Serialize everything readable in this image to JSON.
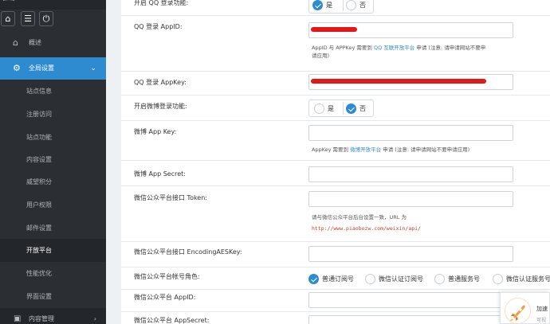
{
  "sidebar": {
    "overview": "概述",
    "global_settings": "全局设置",
    "sub_items": [
      "站点信息",
      "注册访问",
      "站点功能",
      "内容设置",
      "威望积分",
      "用户权限",
      "邮件设置",
      "开放平台",
      "性能优化",
      "界面设置"
    ],
    "active_sub": "开放平台",
    "content_management": "内容管理"
  },
  "form": {
    "qq_login_enable": {
      "label": "开启 QQ 登录功能:",
      "options": [
        "是",
        "否"
      ],
      "selected": "是"
    },
    "qq_appid": {
      "label": "QQ 登录 AppID:",
      "help_pre": "AppID 与 APPKey 需要到",
      "help_link": "QQ 互联开放平台",
      "help_post": "申请 (注意: 请申请网站不要申",
      "help_line2": "请应用)"
    },
    "qq_appkey": {
      "label": "QQ 登录 AppKey:"
    },
    "weibo_enable": {
      "label": "开启微博登录功能:",
      "options": [
        "是",
        "否"
      ],
      "selected": "否"
    },
    "weibo_appkey": {
      "label": "微博 App Key:",
      "help_pre": "AppKey 需要到",
      "help_link": "微博开放平台",
      "help_post": "申请 (注意: 请申请网站不要申请应用)"
    },
    "weibo_secret": {
      "label": "微博 App Secret:"
    },
    "wechat_token": {
      "label": "微信公众平台接口 Token:",
      "help": "请与微信公众平台后台设置一致，URL 为",
      "url": "http://www.piaobozw.com/weixin/api/"
    },
    "wechat_aes": {
      "label": "微信公众平台接口 EncodingAESKey:"
    },
    "wechat_role": {
      "label": "微信公众平台帐号角色:",
      "options": [
        "普通订阅号",
        "微信认证订阅号",
        "普通服务号",
        "微信认证服务号"
      ],
      "selected": "普通订阅号"
    },
    "wechat_appid": {
      "label": "微信公众平台 AppID:"
    },
    "wechat_appsecret": {
      "label": "微信公众平台 AppSecret:"
    }
  },
  "widget": {
    "title": "加速",
    "sub": "可视"
  },
  "colors": {
    "accent": "#2e8bd0",
    "sidebar": "#2b2f33",
    "redaction": "#e01818"
  },
  "icons": [
    "home-icon",
    "list-icon",
    "power-icon",
    "home-outline-icon",
    "gear-icon",
    "chevron-down-icon",
    "book-icon",
    "chevron-right-icon",
    "rocket-icon",
    "check-icon"
  ]
}
